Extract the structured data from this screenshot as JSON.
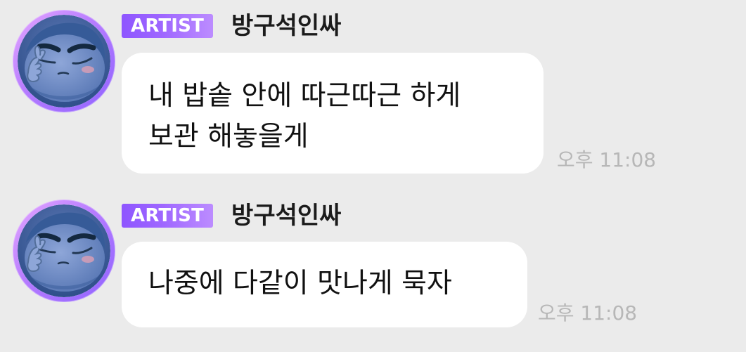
{
  "messages": [
    {
      "badge": "ARTIST",
      "sender": "방구석인싸",
      "text": "내 밥솥 안에 따근따근 하게\n보관 해놓을게",
      "time": "오후 11:08"
    },
    {
      "badge": "ARTIST",
      "sender": "방구석인싸",
      "text": "나중에 다같이 맛나게 묵자",
      "time": "오후 11:08"
    }
  ],
  "icons": {
    "avatar": "blue-round-character-avatar-icon"
  },
  "colors": {
    "background": "#ebebeb",
    "bubble": "#ffffff",
    "badge_start": "#8e55ff",
    "badge_end": "#bc8cff",
    "timestamp": "#b7b7b7",
    "avatar_ring": "#b77cff"
  }
}
